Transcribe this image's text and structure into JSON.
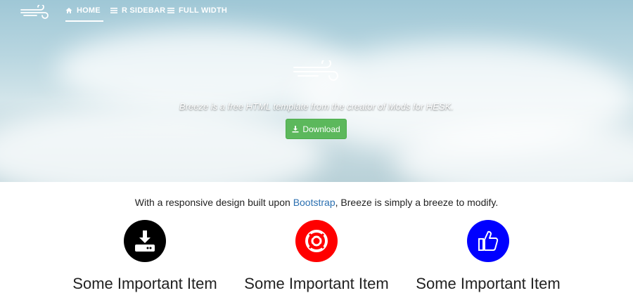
{
  "nav": {
    "items": [
      {
        "label": "HOME",
        "icon": "home-icon",
        "active": true
      },
      {
        "label": "R SIDEBAR",
        "icon": "list-icon",
        "active": false
      },
      {
        "label": "FULL WIDTH",
        "icon": "list-icon",
        "active": false
      }
    ]
  },
  "hero": {
    "tagline": "Breeze is a free HTML template from the creator of Mods for HESK.",
    "download_label": "Download"
  },
  "intro": {
    "before": "With a responsive design built upon ",
    "link": "Bootstrap",
    "after": ", Breeze is simply a breeze to modify."
  },
  "features": [
    {
      "title": "Some Important Item",
      "icon": "download-drive-icon",
      "color": "#000000"
    },
    {
      "title": "Some Important Item",
      "icon": "life-ring-icon",
      "color": "#ff0000"
    },
    {
      "title": "Some Important Item",
      "icon": "thumbs-up-icon",
      "color": "#0000ff"
    }
  ],
  "colors": {
    "accent": "#5cb85c",
    "link": "#2a6fb0"
  }
}
